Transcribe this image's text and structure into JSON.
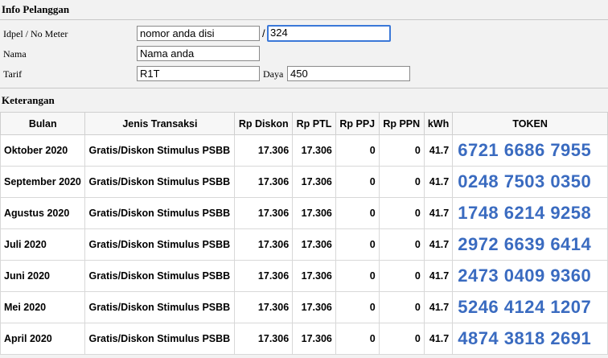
{
  "info": {
    "title": "Info Pelanggan",
    "idpel_label": "Idpel / No Meter",
    "idpel_value": "nomor anda disi",
    "separator": "/",
    "meter_value": "324",
    "nama_label": "Nama",
    "nama_value": "Nama anda",
    "tarif_label": "Tarif",
    "tarif_value": "R1T",
    "daya_label": "Daya",
    "daya_value": "450"
  },
  "keterangan": {
    "title": "Keterangan",
    "headers": [
      "Bulan",
      "Jenis Transaksi",
      "Rp Diskon",
      "Rp PTL",
      "Rp PPJ",
      "Rp PPN",
      "kWh",
      "TOKEN"
    ],
    "rows": [
      {
        "bulan": "Oktober 2020",
        "jenis": "Gratis/Diskon Stimulus PSBB",
        "diskon": "17.306",
        "ptl": "17.306",
        "ppj": "0",
        "ppn": "0",
        "kwh": "41.7",
        "token": "6721 6686 7955"
      },
      {
        "bulan": "September 2020",
        "jenis": "Gratis/Diskon Stimulus PSBB",
        "diskon": "17.306",
        "ptl": "17.306",
        "ppj": "0",
        "ppn": "0",
        "kwh": "41.7",
        "token": "0248 7503 0350"
      },
      {
        "bulan": "Agustus 2020",
        "jenis": "Gratis/Diskon Stimulus PSBB",
        "diskon": "17.306",
        "ptl": "17.306",
        "ppj": "0",
        "ppn": "0",
        "kwh": "41.7",
        "token": "1748 6214 9258"
      },
      {
        "bulan": "Juli 2020",
        "jenis": "Gratis/Diskon Stimulus PSBB",
        "diskon": "17.306",
        "ptl": "17.306",
        "ppj": "0",
        "ppn": "0",
        "kwh": "41.7",
        "token": "2972 6639 6414"
      },
      {
        "bulan": "Juni 2020",
        "jenis": "Gratis/Diskon Stimulus PSBB",
        "diskon": "17.306",
        "ptl": "17.306",
        "ppj": "0",
        "ppn": "0",
        "kwh": "41.7",
        "token": "2473 0409 9360"
      },
      {
        "bulan": "Mei 2020",
        "jenis": "Gratis/Diskon Stimulus PSBB",
        "diskon": "17.306",
        "ptl": "17.306",
        "ppj": "0",
        "ppn": "0",
        "kwh": "41.7",
        "token": "5246 4124 1207"
      },
      {
        "bulan": "April 2020",
        "jenis": "Gratis/Diskon Stimulus PSBB",
        "diskon": "17.306",
        "ptl": "17.306",
        "ppj": "0",
        "ppn": "0",
        "kwh": "41.7",
        "token": "4874 3818 2691"
      }
    ]
  }
}
